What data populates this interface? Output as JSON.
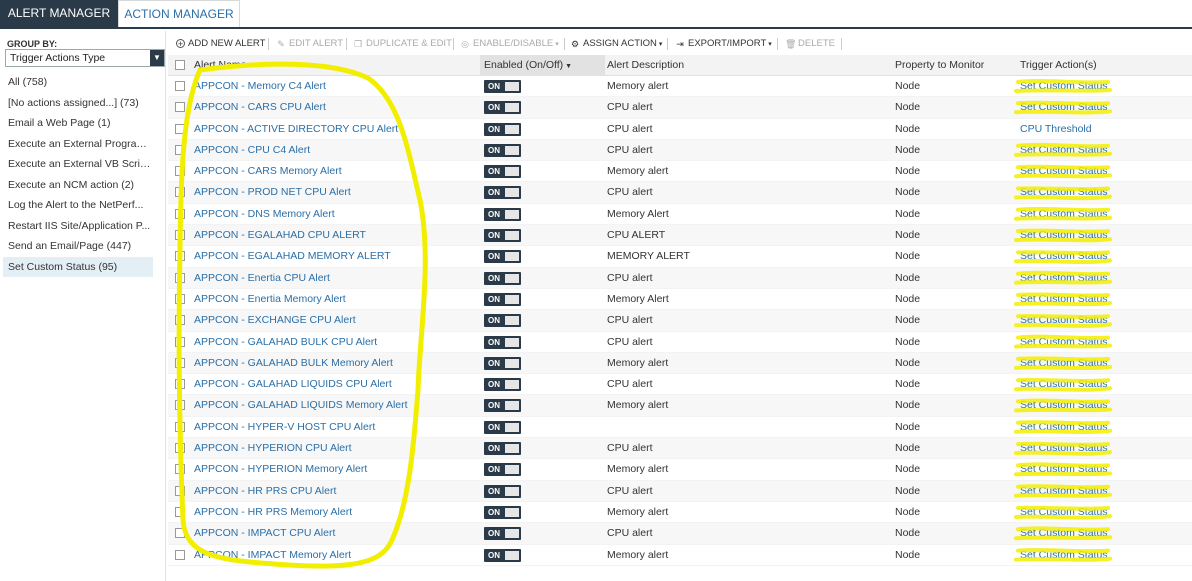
{
  "tabs": {
    "alert_manager": "ALERT MANAGER",
    "action_manager": "ACTION MANAGER"
  },
  "sidebar": {
    "group_by_label": "GROUP BY:",
    "group_by_value": "Trigger Actions Type",
    "items": [
      {
        "label": "All (758)"
      },
      {
        "label": "[No actions assigned...] (73)"
      },
      {
        "label": "Email a Web Page (1)"
      },
      {
        "label": "Execute an External Program..."
      },
      {
        "label": "Execute an External VB Script..."
      },
      {
        "label": "Execute an NCM action (2)"
      },
      {
        "label": "Log the Alert to the NetPerf..."
      },
      {
        "label": "Restart IIS Site/Application P..."
      },
      {
        "label": "Send an Email/Page (447)"
      },
      {
        "label": "Set Custom Status (95)"
      }
    ],
    "selected_index": 9
  },
  "toolbar": {
    "add": "ADD NEW ALERT",
    "edit": "EDIT ALERT",
    "duplicate": "DUPLICATE & EDIT",
    "enable": "ENABLE/DISABLE",
    "assign": "ASSIGN ACTION",
    "export": "EXPORT/IMPORT",
    "delete": "DELETE"
  },
  "table": {
    "headers": {
      "name": "Alert Name",
      "enabled": "Enabled (On/Off)",
      "description": "Alert Description",
      "property": "Property to Monitor",
      "trigger": "Trigger Action(s)"
    },
    "toggle_label": "ON",
    "rows": [
      {
        "name": "APPCON - Memory C4 Alert",
        "description": "Memory alert",
        "property": "Node",
        "trigger": "Set Custom Status"
      },
      {
        "name": "APPCON - CARS CPU Alert",
        "description": "CPU alert",
        "property": "Node",
        "trigger": "Set Custom Status"
      },
      {
        "name": "APPCON - ACTIVE DIRECTORY CPU Alert",
        "description": "CPU alert",
        "property": "Node",
        "trigger": "CPU Threshold"
      },
      {
        "name": "APPCON - CPU C4 Alert",
        "description": "CPU alert",
        "property": "Node",
        "trigger": "Set Custom Status"
      },
      {
        "name": "APPCON - CARS Memory Alert",
        "description": "Memory alert",
        "property": "Node",
        "trigger": "Set Custom Status"
      },
      {
        "name": "APPCON - PROD NET CPU Alert",
        "description": "CPU alert",
        "property": "Node",
        "trigger": "Set Custom Status"
      },
      {
        "name": "APPCON - DNS Memory Alert",
        "description": "Memory Alert",
        "property": "Node",
        "trigger": "Set Custom Status"
      },
      {
        "name": "APPCON - EGALAHAD CPU ALERT",
        "description": "CPU ALERT",
        "property": "Node",
        "trigger": "Set Custom Status"
      },
      {
        "name": "APPCON - EGALAHAD MEMORY ALERT",
        "description": "MEMORY ALERT",
        "property": "Node",
        "trigger": "Set Custom Status"
      },
      {
        "name": "APPCON - Enertia CPU Alert",
        "description": "CPU alert",
        "property": "Node",
        "trigger": "Set Custom Status"
      },
      {
        "name": "APPCON - Enertia Memory Alert",
        "description": "Memory Alert",
        "property": "Node",
        "trigger": "Set Custom Status"
      },
      {
        "name": "APPCON - EXCHANGE CPU Alert",
        "description": "CPU alert",
        "property": "Node",
        "trigger": "Set Custom Status"
      },
      {
        "name": "APPCON - GALAHAD BULK CPU Alert",
        "description": "CPU alert",
        "property": "Node",
        "trigger": "Set Custom Status"
      },
      {
        "name": "APPCON - GALAHAD BULK Memory Alert",
        "description": "Memory alert",
        "property": "Node",
        "trigger": "Set Custom Status"
      },
      {
        "name": "APPCON - GALAHAD LIQUIDS CPU Alert",
        "description": "CPU alert",
        "property": "Node",
        "trigger": "Set Custom Status"
      },
      {
        "name": "APPCON - GALAHAD LIQUIDS Memory Alert",
        "description": "Memory alert",
        "property": "Node",
        "trigger": "Set Custom Status"
      },
      {
        "name": "APPCON - HYPER-V HOST CPU Alert",
        "description": "",
        "property": "Node",
        "trigger": "Set Custom Status"
      },
      {
        "name": "APPCON - HYPERION CPU Alert",
        "description": "CPU alert",
        "property": "Node",
        "trigger": "Set Custom Status"
      },
      {
        "name": "APPCON - HYPERION Memory Alert",
        "description": "Memory alert",
        "property": "Node",
        "trigger": "Set Custom Status"
      },
      {
        "name": "APPCON - HR PRS CPU Alert",
        "description": "CPU alert",
        "property": "Node",
        "trigger": "Set Custom Status"
      },
      {
        "name": "APPCON - HR PRS Memory Alert",
        "description": "Memory alert",
        "property": "Node",
        "trigger": "Set Custom Status"
      },
      {
        "name": "APPCON - IMPACT CPU Alert",
        "description": "CPU alert",
        "property": "Node",
        "trigger": "Set Custom Status"
      },
      {
        "name": "APPCON - IMPACT Memory Alert",
        "description": "Memory alert",
        "property": "Node",
        "trigger": "Set Custom Status"
      }
    ]
  },
  "colors": {
    "tab_dark": "#2b3a48",
    "link_blue": "#2a6fa8",
    "highlight_yellow": "#f2ee00"
  },
  "icons": {
    "add": "plus-circle-icon",
    "edit": "pencil-icon",
    "duplicate": "copy-icon",
    "enable": "toggle-icon",
    "assign": "assign-icon",
    "export": "export-icon",
    "delete": "trash-icon"
  }
}
